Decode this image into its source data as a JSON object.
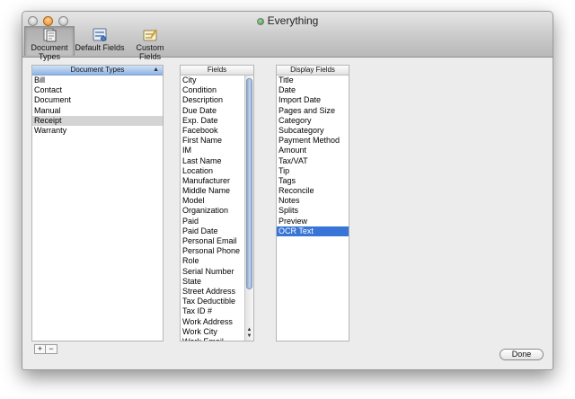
{
  "window": {
    "title": "Everything"
  },
  "toolbar": [
    {
      "label": "Document Types",
      "icon": "document-types-icon",
      "selected": true
    },
    {
      "label": "Default Fields",
      "icon": "default-fields-icon",
      "selected": false
    },
    {
      "label": "Custom Fields",
      "icon": "custom-fields-icon",
      "selected": false
    }
  ],
  "document_types": {
    "header": "Document Types",
    "items": [
      "Bill",
      "Contact",
      "Document",
      "Manual",
      "Receipt",
      "Warranty"
    ],
    "selected": "Receipt"
  },
  "fields": {
    "header": "Fields",
    "items": [
      "City",
      "Condition",
      "Description",
      "Due Date",
      "Exp. Date",
      "Facebook",
      "First Name",
      "IM",
      "Last Name",
      "Location",
      "Manufacturer",
      "Middle Name",
      "Model",
      "Organization",
      "Paid",
      "Paid Date",
      "Personal Email",
      "Personal Phone",
      "Role",
      "Serial Number",
      "State",
      "Street Address",
      "Tax Deductible",
      "Tax ID #",
      "Work Address",
      "Work City",
      "Work Email"
    ]
  },
  "display_fields": {
    "header": "Display Fields",
    "items": [
      "Title",
      "Date",
      "Import Date",
      "Pages and Size",
      "Category",
      "Subcategory",
      "Payment Method",
      "Amount",
      "Tax/VAT",
      "Tip",
      "Tags",
      "Reconcile",
      "Notes",
      "Splits",
      "Preview",
      "OCR Text"
    ],
    "selected": "OCR Text"
  },
  "buttons": {
    "add": "+",
    "remove": "−",
    "done": "Done"
  },
  "colors": {
    "selection_blue": "#3875d7",
    "selection_gray": "#d4d4d4"
  }
}
